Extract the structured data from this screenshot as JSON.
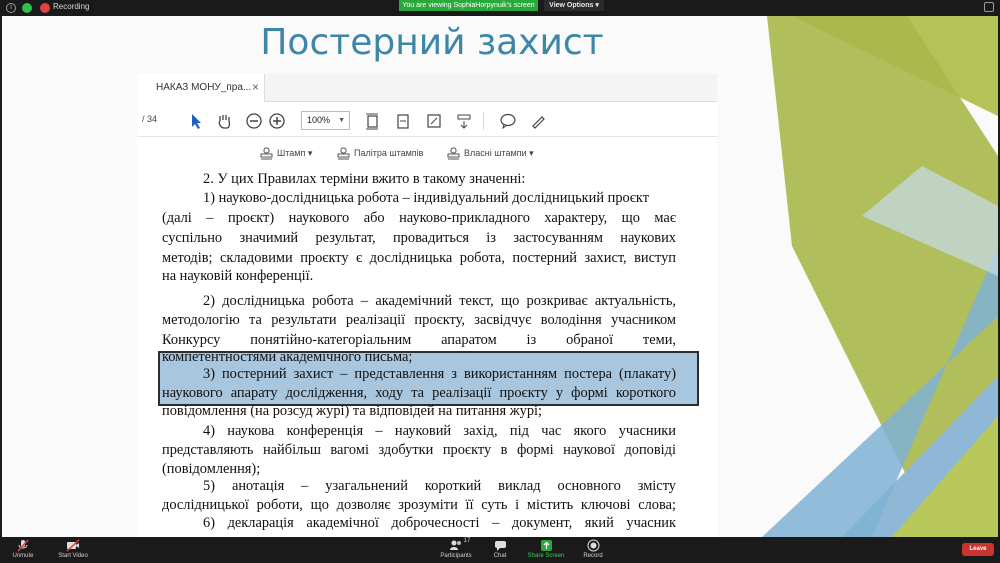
{
  "top_bar": {
    "recording_label": "Recording",
    "viewing_banner": "You are viewing SophiaHorpynuik's screen",
    "view_options_label": "View Options ▾"
  },
  "slide": {
    "title": "Постерний захист"
  },
  "pdf_viewer": {
    "tab_label": "НАКАЗ МОНУ_пра...",
    "tab_close": "×",
    "page_total": "/ 34",
    "zoom_value": "100%",
    "stamp_label": "Штамп ▾",
    "stamp_palette_label": "Палітра штампів",
    "own_stamps_label": "Власні штампи ▾"
  },
  "document": {
    "lines": [
      "2. У цих Правилах терміни вжито в такому значенні:",
      "1) науково-дослідницька робота – індивідуальний дослідницький проєкт",
      "(далі – проєкт) наукового або науково-прикладного характеру, що має",
      "суспільно значимий результат, провадиться із застосуванням наукових",
      "методів; складовими проєкту є дослідницька робота, постерний захист, виступ",
      "на науковій конференції.",
      "2) дослідницька робота – академічний текст, що розкриває актуальність,",
      "методологію та результати реалізації проєкту, засвідчує володіння учасником",
      "Конкурсу понятійно-категоріальним апаратом із обраної теми,",
      "компетентностями академічного письма;",
      "3) постерний захист – представлення з використанням постера (плакату)",
      "наукового апарату дослідження, ходу та реалізації проєкту у формі короткого",
      "повідомлення (на розсуд журі) та відповідей на питання журі;",
      "4) наукова конференція – науковий захід, під час якого учасники",
      "представляють найбільш вагомі здобутки проєкту в формі наукової доповіді",
      "(повідомлення);",
      "5) анотація – узагальнений короткий виклад основного змісту",
      "дослідницької роботи, що дозволяє зрозуміти її суть і містить ключові слова;",
      "6) декларація академічної доброчесності – документ, який учасник"
    ]
  },
  "bottom_bar": {
    "unmute_label": "Unmute",
    "start_video_label": "Start Video",
    "participants_label": "Participants",
    "participants_count": "17",
    "chat_label": "Chat",
    "share_screen_label": "Share Screen",
    "record_label": "Record",
    "leave_label": "Leave"
  },
  "colors": {
    "title": "#3d86a8",
    "highlight": "#a9c6df",
    "share_green": "#2aa83b",
    "leave_red": "#c9342d",
    "deco_olive": "#a7b84a",
    "deco_blue": "#7fb2d4"
  }
}
